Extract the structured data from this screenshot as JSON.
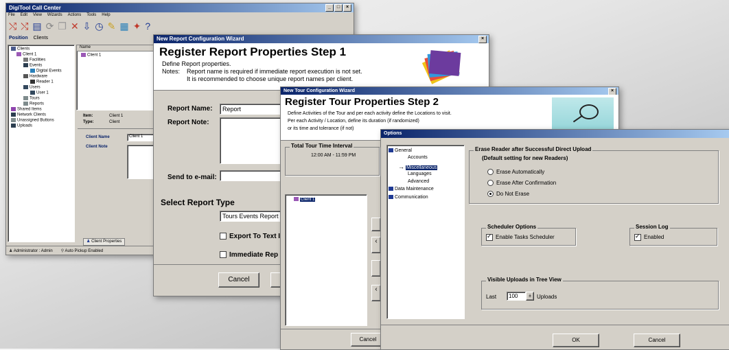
{
  "main_window": {
    "title": "DigiTool Call Center",
    "menu": [
      "File",
      "Edit",
      "View",
      "Wizards",
      "Actions",
      "Tools",
      "Help"
    ],
    "tabs": [
      "Position",
      "Clients"
    ],
    "tree": [
      "Clients",
      "Client 1",
      "Facilities",
      "Events",
      "Digital Events",
      "Hardware",
      "Reader 1",
      "Users",
      "User 1",
      "Tours",
      "Reports",
      "Shared Items",
      "Network Clients",
      "Unassigned Buttons",
      "Uploads"
    ],
    "list_header": "Name",
    "list_item": "Client 1",
    "props": [
      {
        "key": "Item:",
        "value": "Client 1"
      },
      {
        "key": "Type:",
        "value": "Client"
      }
    ],
    "client_name_label": "Client Name",
    "client_name_value": "Client 1",
    "client_note_label": "Client Note",
    "bottom_tab": "Client Properties",
    "status": [
      "Administrator : Admin",
      "Auto Pickup Enabled"
    ],
    "accent": "#0a246a"
  },
  "report_wizard": {
    "title": "New Report Configuration Wizard",
    "heading": "Register Report Properties Step 1",
    "line1": "Define Report properties.",
    "notes_label": "Notes:",
    "note1": "Report name is required if immediate report execution is not set.",
    "note2": "It is recommended to choose unique report names per client.",
    "report_name_label": "Report Name:",
    "report_name_value": "Report",
    "report_note_label": "Report Note:",
    "send_email_label": "Send to e-mail:",
    "select_type_label": "Select Report Type",
    "report_type_value": "Tours Events Report",
    "export_label": "Export To Text I",
    "immediate_label": "Immediate Rep",
    "cancel": "Cancel"
  },
  "tour_wizard": {
    "title": "New Tour Configuration Wizard",
    "heading": "Register Tour Properties Step 2",
    "line1": "Define Activities of the Tour and per each activity define the Locations to visit.",
    "line2": "Per each Activity / Location, define its duration (if randomized)",
    "line3": "or its time and tolerance (if not)",
    "interval_label": "Total Tour Time Interval",
    "interval_value": "12:00 AM - 11:59 PM",
    "client_item": "Client 1",
    "cancel": "Cancel"
  },
  "options": {
    "title": "Options",
    "tree": [
      {
        "label": "General",
        "level": 0
      },
      {
        "label": "Accounts",
        "level": 1
      },
      {
        "label": "Miscellaneous",
        "level": 1,
        "selected": true
      },
      {
        "label": "Languages",
        "level": 1
      },
      {
        "label": "Advanced",
        "level": 1
      },
      {
        "label": "Data Maintenance",
        "level": 0
      },
      {
        "label": "Communication",
        "level": 0
      }
    ],
    "erase_group": "Erase Reader after Successful Direct Upload",
    "erase_sub": "(Default setting for new Readers)",
    "erase_options": [
      {
        "label": "Erase Automatically",
        "selected": false
      },
      {
        "label": "Erase After Confirmation",
        "selected": false
      },
      {
        "label": "Do Not Erase",
        "selected": true
      }
    ],
    "scheduler_group": "Scheduler Options",
    "scheduler_check": "Enable Tasks Scheduler",
    "scheduler_checked": true,
    "session_group": "Session Log",
    "session_check": "Enabled",
    "session_checked": true,
    "uploads_group": "Visible Uploads in Tree View",
    "last_label": "Last",
    "last_value": "100",
    "uploads_label": "Uploads",
    "ok": "OK",
    "cancel": "Cancel"
  }
}
